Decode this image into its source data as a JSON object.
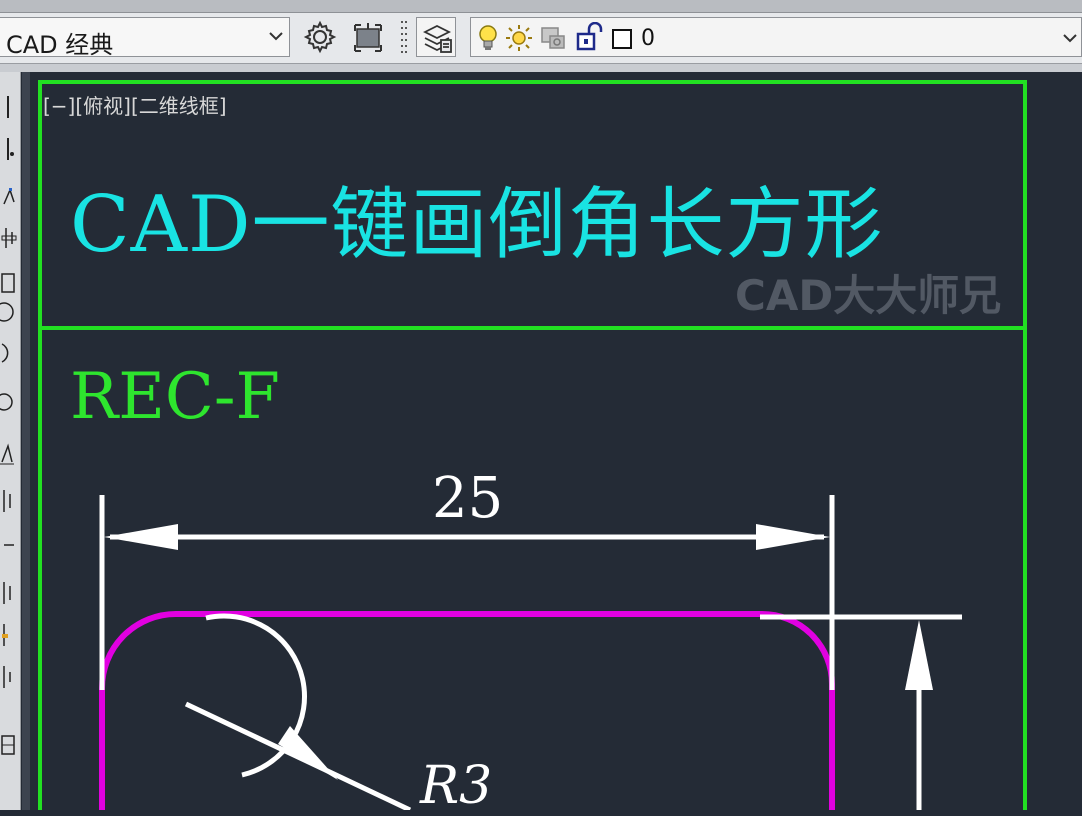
{
  "toolbar": {
    "workspace": {
      "value": "CAD 经典",
      "icon": "chevron-down-icon"
    },
    "buttons": [
      {
        "name": "workspace-settings-button",
        "icon": "gear-icon"
      },
      {
        "name": "customize-toolbar-button",
        "icon": "customize-icon"
      },
      {
        "name": "layer-properties-button",
        "icon": "layer-properties-icon"
      }
    ],
    "layer": {
      "icons": [
        "lightbulb-icon",
        "sun-icon",
        "printer-icon",
        "unlock-icon",
        "color-swatch-icon"
      ],
      "name": "0"
    }
  },
  "canvas": {
    "viewport_label": "[−][俯视][二维线框]",
    "title": "CAD一键画倒角长方形",
    "watermark": "CAD大大师兄",
    "command": "REC-F",
    "dimension": "25",
    "radius": "R3",
    "colors": {
      "background": "#242b36",
      "frame": "#22e022",
      "title": "#19e3e3",
      "rectangle": "#e100e1",
      "dimension": "#ffffff"
    }
  }
}
